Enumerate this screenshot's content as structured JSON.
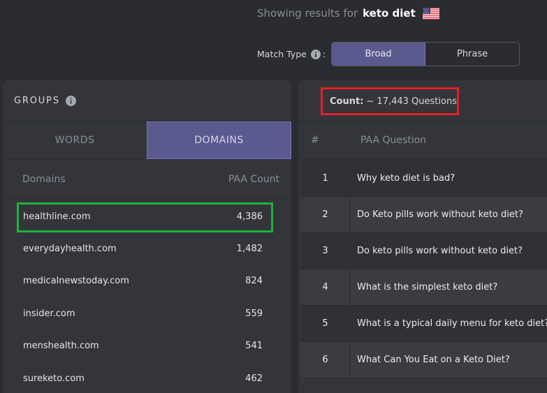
{
  "header": {
    "showing_prefix": "Showing results for",
    "keyword": "keto diet",
    "flag_icon": "us-flag-icon"
  },
  "match_type": {
    "label": "Match Type",
    "colon": ":",
    "options": [
      "Broad",
      "Phrase"
    ],
    "selected": "Broad"
  },
  "groups": {
    "title": "GROUPS",
    "tabs": [
      "WORDS",
      "DOMAINS"
    ],
    "active_tab": "DOMAINS",
    "columns": [
      "Domains",
      "PAA Count"
    ],
    "rows": [
      {
        "domain": "healthline.com",
        "count": "4,386"
      },
      {
        "domain": "everydayhealth.com",
        "count": "1,482"
      },
      {
        "domain": "medicalnewstoday.com",
        "count": "824"
      },
      {
        "domain": "insider.com",
        "count": "559"
      },
      {
        "domain": "menshealth.com",
        "count": "541"
      },
      {
        "domain": "sureketo.com",
        "count": "462"
      }
    ]
  },
  "questions": {
    "count_label": "Count:",
    "count_value": "~ 17,443 Questions",
    "columns": [
      "#",
      "PAA Question"
    ],
    "rows": [
      {
        "n": "1",
        "q": "Why keto diet is bad?"
      },
      {
        "n": "2",
        "q": "Do Keto pills work without keto diet?"
      },
      {
        "n": "3",
        "q": "Do keto pills work without keto diet?"
      },
      {
        "n": "4",
        "q": "What is the simplest keto diet?"
      },
      {
        "n": "5",
        "q": "What is a typical daily menu for keto diet?"
      },
      {
        "n": "6",
        "q": "What Can You Eat on a Keto Diet?"
      }
    ]
  },
  "colors": {
    "accent": "#5b5a8e",
    "highlight_green": "#1db33a",
    "highlight_red": "#e32026"
  }
}
